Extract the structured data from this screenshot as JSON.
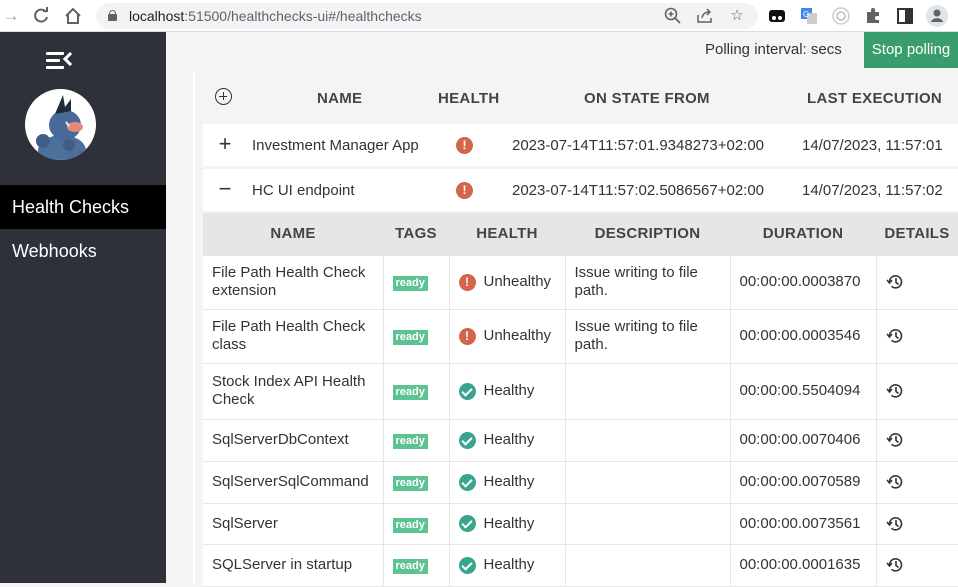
{
  "browser": {
    "url_host": "localhost",
    "url_rest": ":51500/healthchecks-ui#/healthchecks",
    "icons": [
      "back-icon",
      "reload-icon",
      "home-icon",
      "lock-icon",
      "zoom-icon",
      "share-icon",
      "bookmark-star-icon",
      "extension-incognito-icon",
      "google-translate-icon",
      "extension-circle-icon",
      "extensions-puzzle-icon",
      "side-panel-icon",
      "profile-icon"
    ]
  },
  "sidebar": {
    "items": [
      {
        "label": "Health Checks",
        "active": true
      },
      {
        "label": "Webhooks",
        "active": false
      }
    ]
  },
  "topbar": {
    "polling_label": "Polling interval: secs",
    "stop_button": "Stop polling"
  },
  "colors": {
    "sidebar_bg": "#2f313a",
    "active_nav_bg": "#000000",
    "stop_button_bg": "#3a9d6e",
    "unhealthy": "#d2664c",
    "healthy": "#3aa58f",
    "tag_bg": "#5ec392"
  },
  "table": {
    "headers": {
      "name": "NAME",
      "health": "HEALTH",
      "on_state_from": "ON STATE FROM",
      "last_execution": "LAST EXECUTION"
    },
    "rows": [
      {
        "expand": "+",
        "name": "Investment Manager App",
        "health": "Unhealthy",
        "on_state_from": "2023-07-14T11:57:01.9348273+02:00",
        "last_execution": "14/07/2023, 11:57:01"
      },
      {
        "expand": "−",
        "name": "HC UI endpoint",
        "health": "Unhealthy",
        "on_state_from": "2023-07-14T11:57:02.5086567+02:00",
        "last_execution": "14/07/2023, 11:57:02"
      }
    ]
  },
  "details": {
    "headers": {
      "name": "NAME",
      "tags": "TAGS",
      "health": "HEALTH",
      "description": "DESCRIPTION",
      "duration": "DURATION",
      "details": "DETAILS"
    },
    "rows": [
      {
        "name": "File Path Health Check extension",
        "tag": "ready",
        "health": "Unhealthy",
        "description": "Issue writing to file path.",
        "duration": "00:00:00.0003870"
      },
      {
        "name": "File Path Health Check class",
        "tag": "ready",
        "health": "Unhealthy",
        "description": "Issue writing to file path.",
        "duration": "00:00:00.0003546"
      },
      {
        "name": "Stock Index API Health Check",
        "tag": "ready",
        "health": "Healthy",
        "description": "",
        "duration": "00:00:00.5504094"
      },
      {
        "name": "SqlServerDbContext",
        "tag": "ready",
        "health": "Healthy",
        "description": "",
        "duration": "00:00:00.0070406"
      },
      {
        "name": "SqlServerSqlCommand",
        "tag": "ready",
        "health": "Healthy",
        "description": "",
        "duration": "00:00:00.0070589"
      },
      {
        "name": "SqlServer",
        "tag": "ready",
        "health": "Healthy",
        "description": "",
        "duration": "00:00:00.0073561"
      },
      {
        "name": "SQLServer in startup",
        "tag": "ready",
        "health": "Healthy",
        "description": "",
        "duration": "00:00:00.0001635"
      }
    ]
  }
}
